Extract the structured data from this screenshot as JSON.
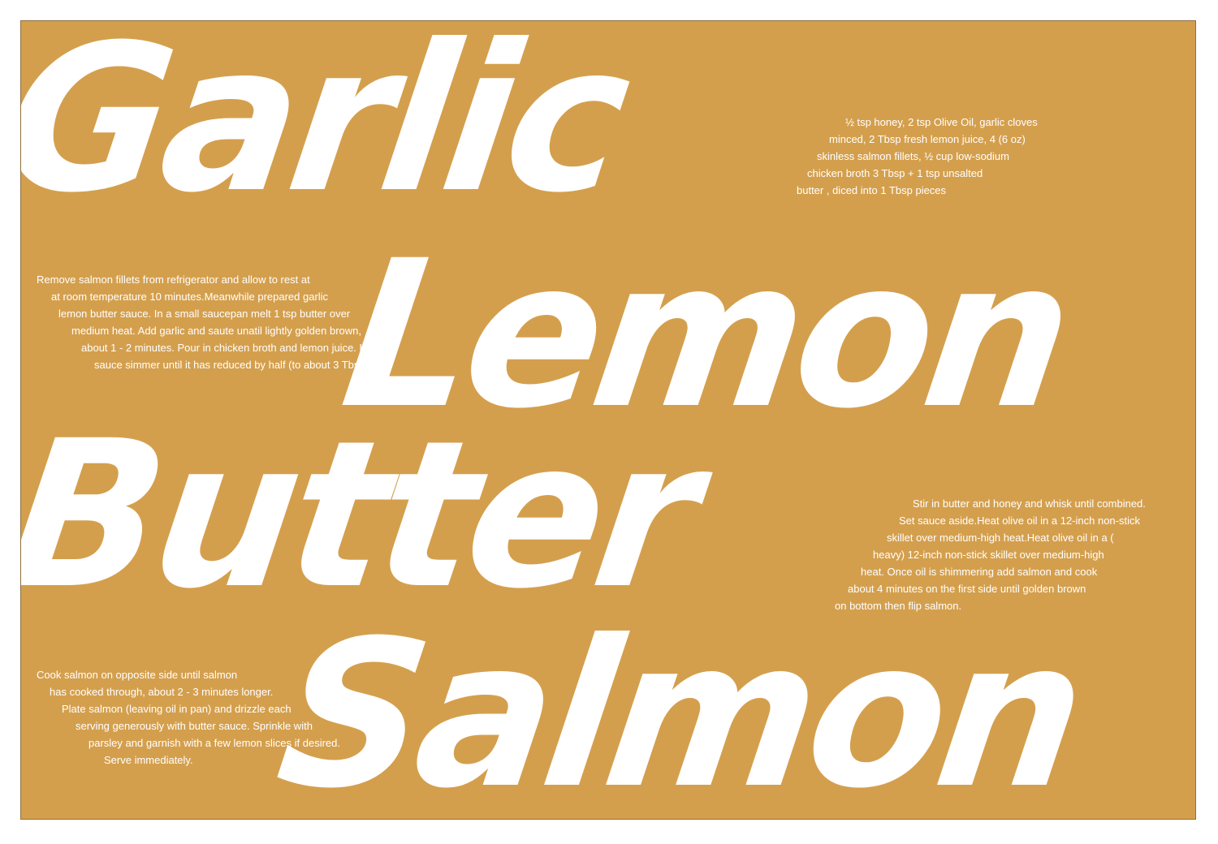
{
  "title_words": [
    "Garlic",
    "Lemon",
    "Butter",
    "Salmon"
  ],
  "ingredients": [
    "½ tsp honey, 2 tsp Olive Oil, garlic cloves",
    "minced, 2 Tbsp fresh lemon juice, 4 (6 oz)",
    "skinless salmon fillets, ½ cup low-sodium",
    "chicken broth 3 Tbsp + 1 tsp unsalted",
    "butter , diced into 1 Tbsp pieces"
  ],
  "step_1": [
    "Remove salmon fillets from refrigerator and allow to rest at",
    "at room temperature 10 minutes.Meanwhile prepared garlic",
    "lemon butter sauce. In a small saucepan melt 1 tsp butter over",
    "medium heat. Add garlic and saute unatil lightly golden brown,",
    "about 1 - 2 minutes. Pour in chicken broth and lemon juice. Let",
    "sauce simmer until it has reduced by half (to about 3 Tbsp)"
  ],
  "step_2": [
    "Stir in butter and honey and whisk until combined.",
    "Set sauce aside.Heat olive oil in a 12-inch non-stick",
    "skillet over medium-high heat.Heat olive oil in a  (",
    "heavy) 12-inch non-stick skillet over medium-high",
    "heat. Once oil is shimmering add salmon and cook",
    "about 4 minutes on the first side until golden brown",
    "on bottom then flip salmon."
  ],
  "step_3": [
    "Cook salmon on opposite side until salmon",
    "has cooked through, about 2 - 3 minutes longer.",
    "Plate salmon  (leaving oil in pan) and drizzle each",
    "serving generously with butter sauce. Sprinkle with",
    "parsley and garnish with a few lemon slices if desired.",
    "Serve immediately."
  ],
  "colors": {
    "background": "#d49f4d",
    "text": "#ffffff",
    "page": "#ffffff"
  }
}
